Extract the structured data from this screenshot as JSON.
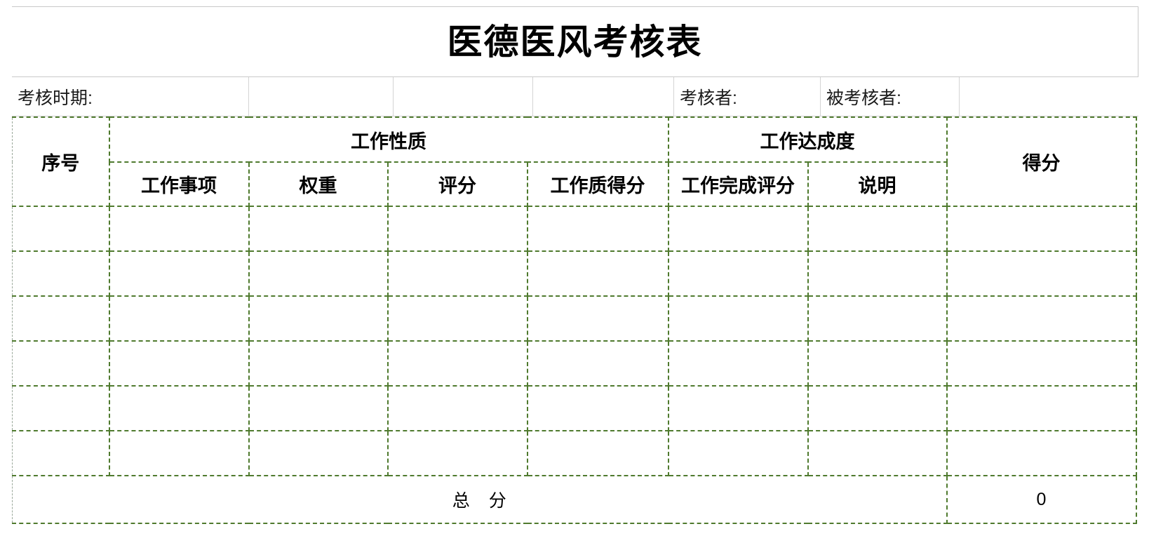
{
  "document": {
    "title": "医德医风考核表"
  },
  "meta": {
    "fields": [
      {
        "label": "考核时期:",
        "value": ""
      },
      {
        "label": "",
        "value": ""
      },
      {
        "label": "",
        "value": ""
      },
      {
        "label": "",
        "value": ""
      },
      {
        "label": "考核者:",
        "value": ""
      },
      {
        "label": "被考核者:",
        "value": ""
      },
      {
        "label": "",
        "value": ""
      }
    ]
  },
  "table": {
    "header": {
      "seq": "序号",
      "group_work_nature": "工作性质",
      "group_work_achievement": "工作达成度",
      "score": "得分",
      "sub": {
        "work_item": "工作事项",
        "weight": "权重",
        "rating": "评分",
        "work_quality_score": "工作质得分",
        "work_completion_score": "工作完成评分",
        "remark": "说明"
      }
    },
    "rows": [
      {
        "seq": "",
        "work_item": "",
        "weight": "",
        "rating": "",
        "work_quality_score": "",
        "work_completion_score": "",
        "remark": "",
        "score": ""
      },
      {
        "seq": "",
        "work_item": "",
        "weight": "",
        "rating": "",
        "work_quality_score": "",
        "work_completion_score": "",
        "remark": "",
        "score": ""
      },
      {
        "seq": "",
        "work_item": "",
        "weight": "",
        "rating": "",
        "work_quality_score": "",
        "work_completion_score": "",
        "remark": "",
        "score": ""
      },
      {
        "seq": "",
        "work_item": "",
        "weight": "",
        "rating": "",
        "work_quality_score": "",
        "work_completion_score": "",
        "remark": "",
        "score": ""
      },
      {
        "seq": "",
        "work_item": "",
        "weight": "",
        "rating": "",
        "work_quality_score": "",
        "work_completion_score": "",
        "remark": "",
        "score": ""
      },
      {
        "seq": "",
        "work_item": "",
        "weight": "",
        "rating": "",
        "work_quality_score": "",
        "work_completion_score": "",
        "remark": "",
        "score": ""
      }
    ],
    "total": {
      "label": "总 分",
      "value": "0"
    }
  },
  "colors": {
    "grid_border": "#4f7a2e",
    "meta_border": "#d4d4d4",
    "title_border": "#c9c9c9",
    "text": "#000000",
    "background": "#ffffff"
  }
}
